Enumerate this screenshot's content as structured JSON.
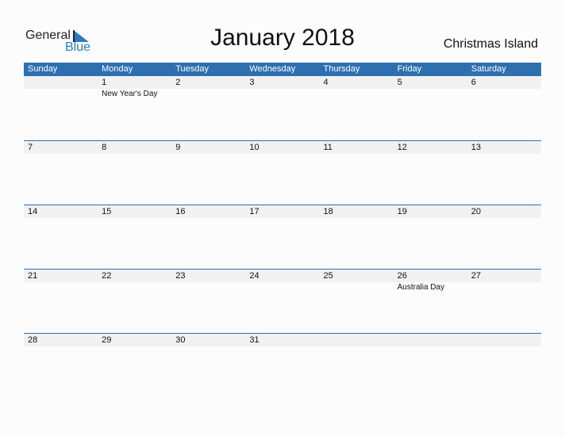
{
  "logo": {
    "general": "General",
    "blue": "Blue",
    "accent_color": "#2a7bc1"
  },
  "title": "January 2018",
  "country": "Christmas Island",
  "header_color": "#2e6fb0",
  "weekdays": [
    "Sunday",
    "Monday",
    "Tuesday",
    "Wednesday",
    "Thursday",
    "Friday",
    "Saturday"
  ],
  "weeks": [
    {
      "days": [
        "",
        "1",
        "2",
        "3",
        "4",
        "5",
        "6"
      ],
      "events": [
        "",
        "New Year's Day",
        "",
        "",
        "",
        "",
        ""
      ]
    },
    {
      "days": [
        "7",
        "8",
        "9",
        "10",
        "11",
        "12",
        "13"
      ],
      "events": [
        "",
        "",
        "",
        "",
        "",
        "",
        ""
      ]
    },
    {
      "days": [
        "14",
        "15",
        "16",
        "17",
        "18",
        "19",
        "20"
      ],
      "events": [
        "",
        "",
        "",
        "",
        "",
        "",
        ""
      ]
    },
    {
      "days": [
        "21",
        "22",
        "23",
        "24",
        "25",
        "26",
        "27"
      ],
      "events": [
        "",
        "",
        "",
        "",
        "",
        "Australia Day",
        ""
      ]
    },
    {
      "days": [
        "28",
        "29",
        "30",
        "31",
        "",
        "",
        ""
      ],
      "events": [
        "",
        "",
        "",
        "",
        "",
        "",
        ""
      ]
    }
  ]
}
